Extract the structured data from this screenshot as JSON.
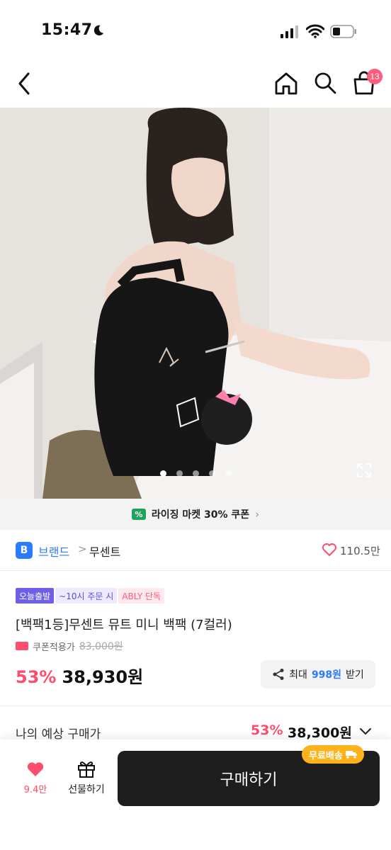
{
  "status_bar": {
    "time": "15:47",
    "icons": [
      "moon-icon",
      "signal-icon",
      "wifi-icon",
      "battery-icon"
    ]
  },
  "nav": {
    "icons": [
      "back-icon",
      "home-icon",
      "search-icon",
      "cart-icon"
    ],
    "cart_badge": "13"
  },
  "gallery": {
    "total_images": 5,
    "active_index": 0
  },
  "coupon_banner": {
    "text": "라이징 마켓 30% 쿠폰",
    "arrow": "›"
  },
  "brand": {
    "badge": "B",
    "label": "브랜드",
    "separator": ">",
    "name": "무센트",
    "like_count": "110.5만"
  },
  "product": {
    "tags": [
      "오늘출발",
      "~10시 주문 시",
      "ABLY 단독"
    ],
    "name": "[백팩1등]무센트 뮤트 미니 백팩 (7컬러)",
    "coupon_label": "쿠폰적용가",
    "original_price": "83,000원",
    "discount": "53%",
    "price": "38,930원",
    "reward": {
      "prefix": "최대",
      "amount": "998원",
      "suffix": "받기"
    }
  },
  "estimate": {
    "label": "나의 예상 구매가",
    "discount": "53%",
    "price": "38,300원"
  },
  "bottom_bar": {
    "like_count": "9.4만",
    "gift_label": "선물하기",
    "buy_label": "구매하기",
    "free_shipping": "무료배송"
  },
  "colors": {
    "accent_pink": "#ff4d6d",
    "brand_blue": "#2b7bff",
    "buy_button": "#1e1e1f",
    "shipping_badge": "#ffb21a",
    "coupon_green": "#1fa35b"
  }
}
